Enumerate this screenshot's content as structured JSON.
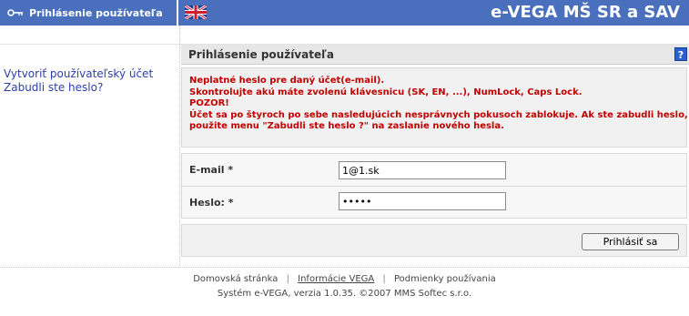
{
  "header": {
    "section_title": "Prihlásenie používateľa",
    "app_title": "e-VEGA MŠ SR a SAV",
    "key_icon": "key-icon",
    "flag_icon": "uk-flag-icon"
  },
  "sidebar": {
    "links": [
      {
        "label": "Vytvoriť používateľský účet"
      },
      {
        "label": "Zabudli ste heslo?"
      }
    ]
  },
  "content": {
    "title": "Prihlásenie používateľa",
    "help_label": "?"
  },
  "error": {
    "lines": [
      "Neplatné heslo pre daný účet(e-mail).",
      "Skontrolujte akú máte zvolenú klávesnicu (SK, EN, ...), NumLock, Caps Lock.",
      "POZOR!",
      "Účet sa po štyroch po sebe nasledujúcich nesprávnych pokusoch zablokuje. Ak ste zabudli heslo,",
      "použite menu \"Zabudli ste heslo ?\" na zaslanie nového hesla."
    ],
    "color": "#c00000"
  },
  "form": {
    "email_label": "E-mail  *",
    "email_value": "1@1.sk",
    "password_label": "Heslo: *",
    "password_value": "•••••"
  },
  "actions": {
    "login_label": "Prihlásiť sa"
  },
  "footer": {
    "links": [
      "Domovská stránka",
      "Informácie VEGA",
      "Podmienky používania"
    ],
    "separator": "|",
    "copyright": "Systém e-VEGA, verzia 1.0.35. ©2007 MMS Softec s.r.o."
  },
  "colors": {
    "header_bg": "#4a6fbd",
    "link": "#2b3fa6",
    "panel_bg": "#f1f1f1"
  }
}
